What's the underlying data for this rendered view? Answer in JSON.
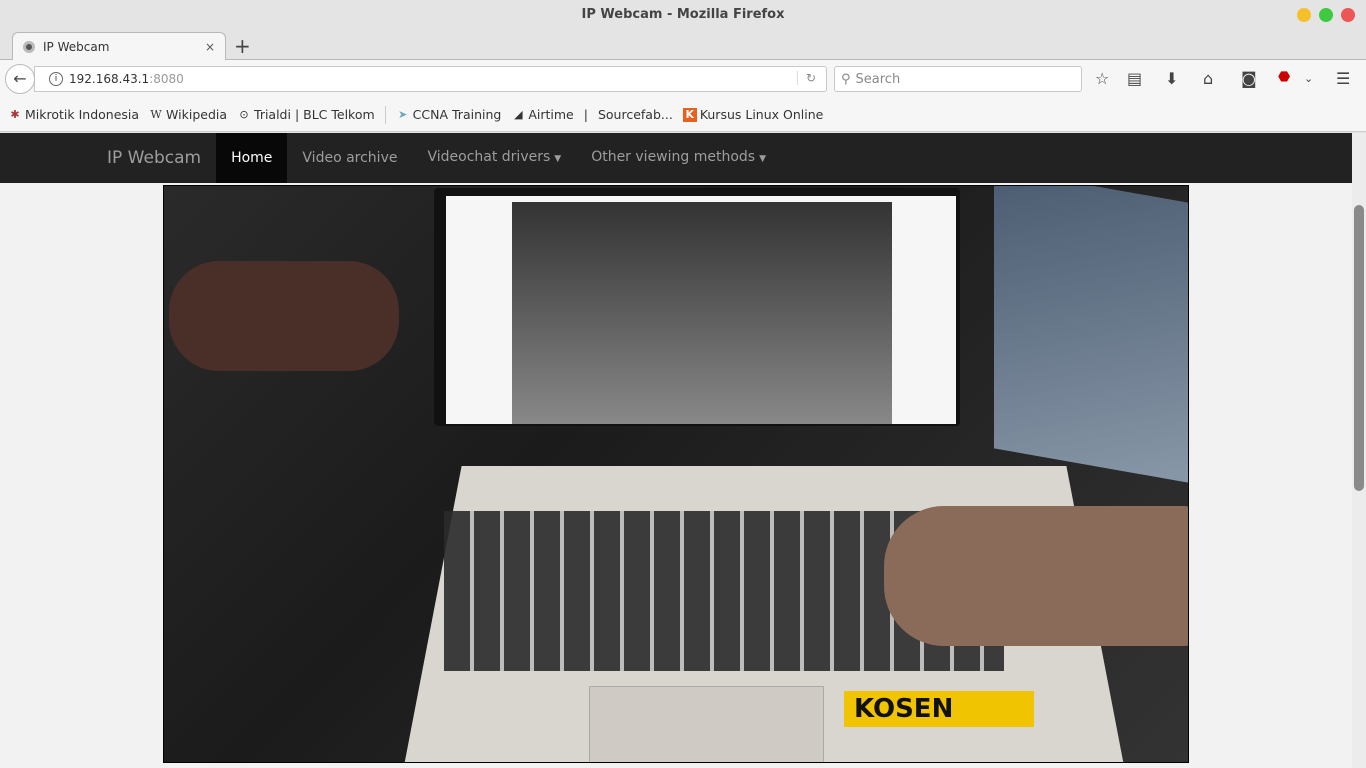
{
  "window": {
    "title": "IP Webcam - Mozilla Firefox",
    "controls": {
      "minimize_color": "#f5c02a",
      "maximize_color": "#3fcb3f",
      "close_color": "#ee5555"
    }
  },
  "tab": {
    "label": "IP Webcam",
    "close": "×",
    "new_tab": "+"
  },
  "toolbar": {
    "url_host": "192.168.43.1",
    "url_port": ":8080",
    "search_placeholder": "Search"
  },
  "bookmarks": [
    {
      "label": "Mikrotik Indonesia",
      "icon": "mikrotik-icon"
    },
    {
      "label": "Wikipedia",
      "icon": "W"
    },
    {
      "label": "Trialdi | BLC Telkom",
      "icon": "telkom-icon"
    },
    {
      "label": "CCNA Training",
      "icon": "ccna-icon"
    },
    {
      "label": "Airtime",
      "icon": "airtime-icon"
    },
    {
      "label": "|",
      "icon": ""
    },
    {
      "label": "Sourcefab...",
      "icon": ""
    },
    {
      "label": "Kursus Linux Online",
      "icon": "K"
    }
  ],
  "site": {
    "brand": "IP Webcam",
    "nav": [
      {
        "label": "Home",
        "active": true
      },
      {
        "label": "Video archive"
      },
      {
        "label": "Videochat drivers",
        "dropdown": true
      },
      {
        "label": "Other viewing methods",
        "dropdown": true
      }
    ]
  },
  "video": {
    "overlay_logo": "KOSEN"
  }
}
